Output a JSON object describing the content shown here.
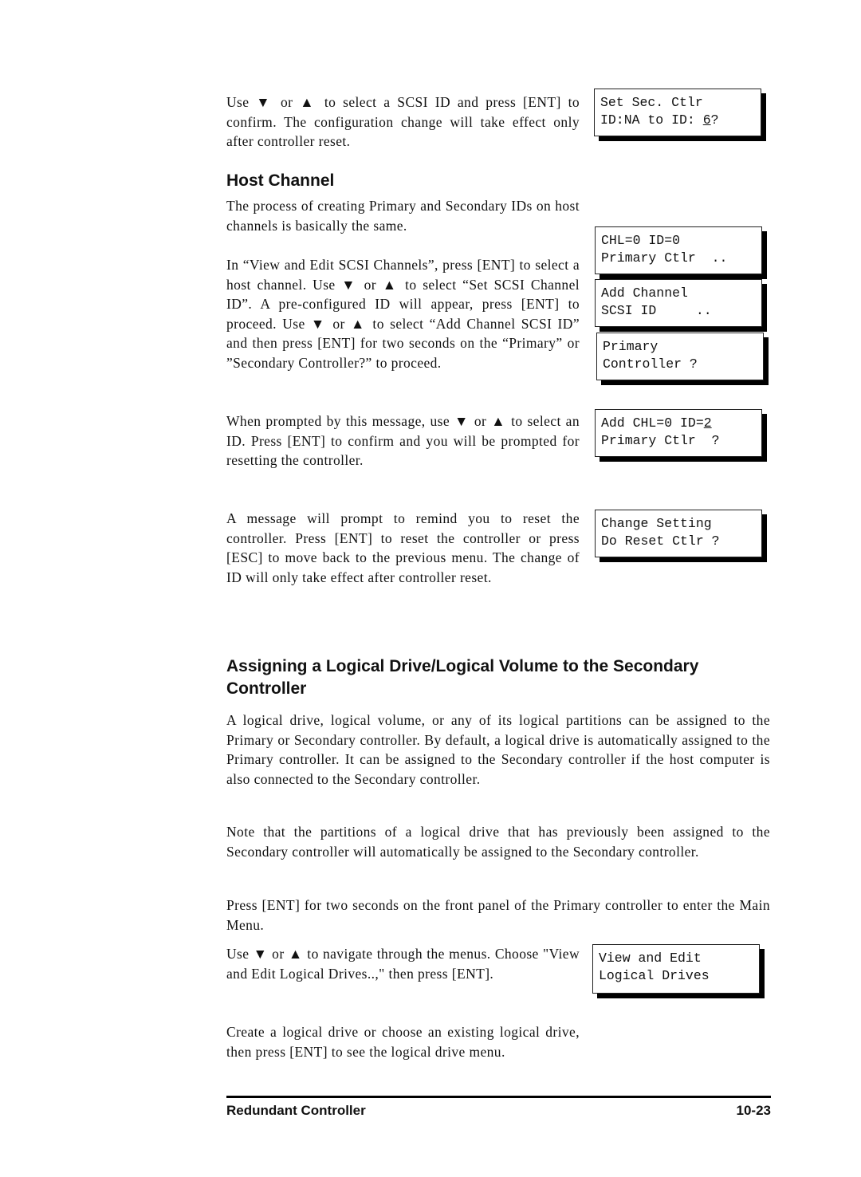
{
  "paragraphs": {
    "p1": "Use ▼ or ▲ to select a SCSI ID and press [ENT] to confirm. The configuration change will take effect only after controller reset.",
    "p2": "The process of creating Primary and Secondary IDs on host channels is basically the same.",
    "p3": "In “View and Edit SCSI Channels”, press [ENT] to select a host channel. Use ▼ or ▲ to select “Set SCSI Channel ID”. A pre-configured ID will appear, press [ENT] to proceed. Use ▼ or ▲ to select “Add Channel SCSI ID” and then press [ENT] for two seconds on the “Primary” or ”Secondary Controller?” to proceed.",
    "p4": "When prompted by this message, use ▼ or ▲ to select an ID. Press [ENT] to confirm and you will be prompted for resetting the controller.",
    "p5": "A message will prompt to remind you to reset the controller. Press [ENT] to reset the controller or press [ESC] to move back to the previous menu. The change of ID will only take effect after controller reset.",
    "p6": "A logical drive, logical volume, or any of its logical partitions can be assigned to the Primary or Secondary controller. By default, a logical drive is automatically assigned to the Primary controller. It can be assigned to the Secondary controller if the host computer is also connected to the Secondary controller.",
    "p7": "Note that the partitions of a logical drive that has previously been assigned to the Secondary controller will automatically be assigned to the Secondary controller.",
    "p8": "Press [ENT] for two seconds on the front panel of the Primary controller to enter the Main Menu.",
    "p9": "Use ▼ or ▲ to navigate through the menus. Choose \"View and Edit Logical Drives..,\" then press [ENT].",
    "p10": "Create a logical drive or choose an existing logical drive, then press [ENT] to see the logical drive menu."
  },
  "headings": {
    "host_channel": "Host Channel",
    "assigning": "Assigning a Logical Drive/Logical Volume to the Secondary Controller"
  },
  "lcd": {
    "set_sec_l1": "Set Sec. Ctlr",
    "set_sec_l2a": "ID:NA to ID: ",
    "set_sec_l2b": "6",
    "set_sec_l2c": "?",
    "chl_l1": "CHL=0 ID=0",
    "chl_l2": "Primary Ctlr  ..",
    "add_l1": "Add Channel",
    "add_l2": "SCSI ID     ..",
    "prim_l1": "Primary",
    "prim_l2": "Controller ?",
    "addchl_l1a": "Add CHL=0 ID=",
    "addchl_l1b": "2",
    "addchl_l2": "Primary Ctlr  ?",
    "change_l1": "Change Setting",
    "change_l2": "Do Reset Ctlr ?",
    "view_l1": "View and Edit",
    "view_l2": "Logical Drives"
  },
  "footer": {
    "section": "Redundant Controller",
    "page": "10-23"
  }
}
